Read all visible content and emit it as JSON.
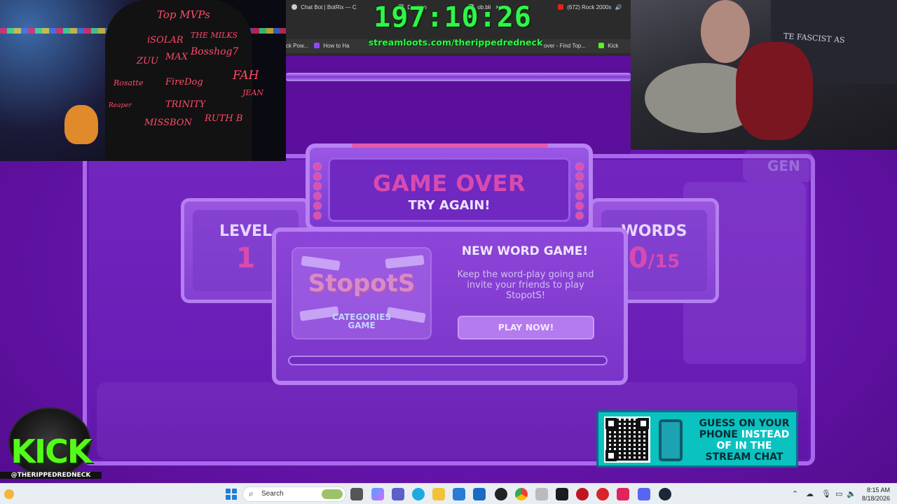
{
  "stream_overlay": {
    "timer": "197:10:26",
    "streamloots_url": "streamloots.com/therippedredneck",
    "kick_logo_text": "KICK",
    "kick_handle": "@THERIPPEDREDNECK"
  },
  "browser": {
    "tabs": [
      {
        "label": "Chat Bot | BotRix — C",
        "icon": "botrix-icon"
      },
      {
        "label": "Dashbo",
        "icon": "dashboard-icon"
      },
      {
        "label": "ob.bli",
        "icon": "tab-icon"
      },
      {
        "label": "(672) Rock 2000s",
        "icon": "youtube-icon"
      }
    ],
    "bookmarks": [
      {
        "label": "ck Pow...",
        "icon": "bookmark-icon"
      },
      {
        "label": "How to Ha",
        "icon": "twitch-icon"
      },
      {
        "label": "over - Find Top...",
        "icon": "bookmark-icon"
      },
      {
        "label": "Kick",
        "icon": "kick-icon"
      }
    ]
  },
  "webcam_left": {
    "chair_names": [
      "Top MVPs",
      "iSOLAR",
      "THE MILKS",
      "ZUU",
      "MAX",
      "Bosshog7",
      "Rosatte",
      "FireDog",
      "FAH",
      "JEAN",
      "Reaper",
      "TRINITY",
      "MISSBON",
      "RUTH B"
    ]
  },
  "webcam_right": {
    "blanket_text": "TE FASCIST AS"
  },
  "game": {
    "header": {
      "title": "GAME OVER",
      "subtitle": "TRY AGAIN!"
    },
    "level": {
      "label": "LEVEL",
      "value": "1"
    },
    "words": {
      "label": "WORDS",
      "value": "0",
      "total": "/15"
    },
    "promo": {
      "logo": "StopotS",
      "logo_caption_line1": "CATEGORIES",
      "logo_caption_line2": "GAME",
      "title": "NEW WORD GAME!",
      "body": "Keep the word-play going and invite your friends to play StopotS!",
      "button": "PLAY NOW!"
    },
    "side_card_title": "GEN"
  },
  "qr_overlay": {
    "line1_dark": "GUESS ON YOUR",
    "line2_dark": "PHONE",
    "line2_light": "INSTEAD",
    "line3_light": "OF IN THE",
    "line4_dark": "STREAM CHAT"
  },
  "taskbar": {
    "search_placeholder": "Search",
    "time": "8:15 AM",
    "date": "8/18/2026",
    "apps": [
      "file-explorer-icon",
      "copilot-icon",
      "teams-icon",
      "edge-icon",
      "folder-icon",
      "store-icon",
      "outlook-icon",
      "obs-icon",
      "chrome-icon",
      "tool-icon",
      "terminal-icon",
      "record-icon",
      "gta-icon",
      "audio-icon",
      "discord-icon",
      "steam-icon"
    ]
  }
}
